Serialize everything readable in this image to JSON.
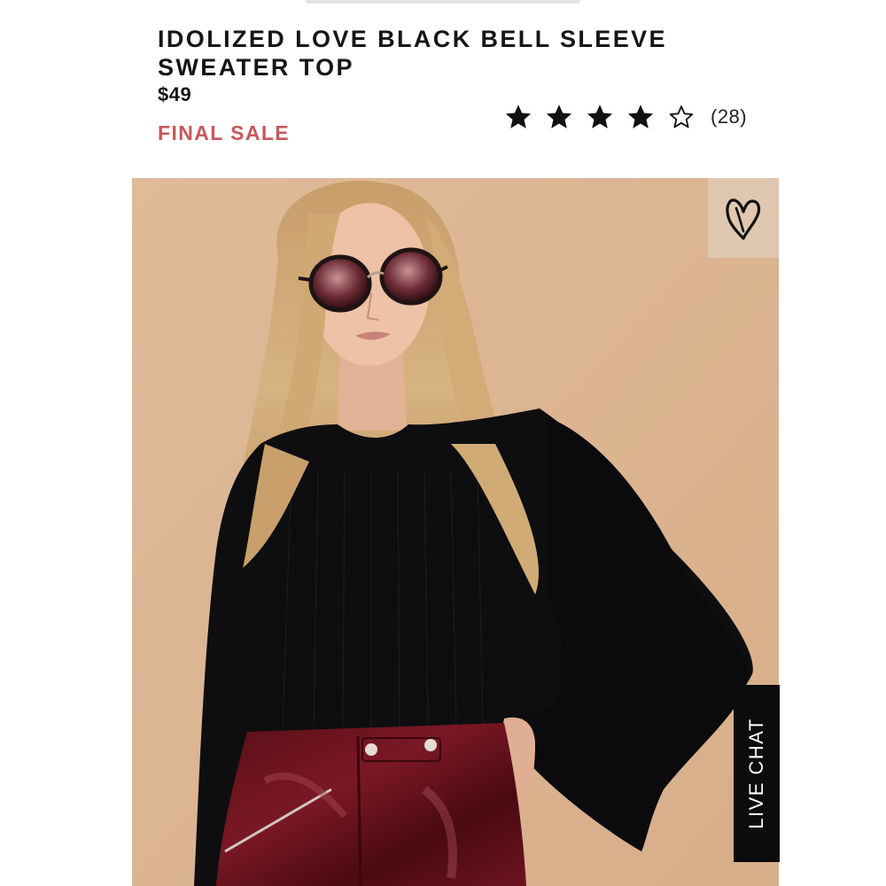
{
  "product": {
    "title": "IDOLIZED LOVE BLACK BELL SLEEVE SWEATER TOP",
    "price": "$49",
    "sale_label": "FINAL SALE",
    "rating": {
      "stars_filled": 4,
      "stars_total": 5,
      "review_count_label": "(28)"
    },
    "image": {
      "description_icon": "product-photo"
    }
  },
  "actions": {
    "wishlist_icon": "heart-icon",
    "live_chat_label": "LIVE CHAT"
  },
  "colors": {
    "sale": "#c7585b",
    "text": "#161616",
    "photo_background": "#dcb592",
    "live_chat_bg": "#0c0c0c"
  }
}
